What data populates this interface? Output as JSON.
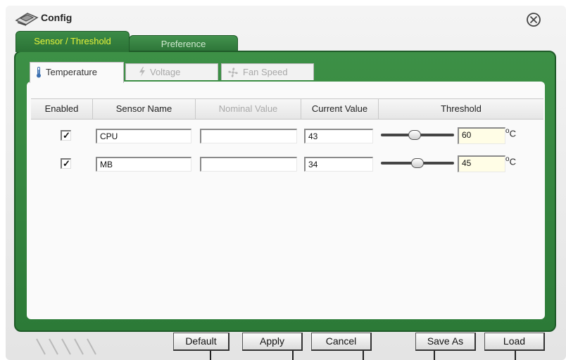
{
  "window": {
    "title": "Config"
  },
  "main_tabs": [
    {
      "label": "Sensor / Threshold",
      "active": true
    },
    {
      "label": "Preference",
      "active": false
    }
  ],
  "sub_tabs": [
    {
      "label": "Temperature",
      "icon": "thermometer-icon",
      "active": true
    },
    {
      "label": "Voltage",
      "icon": "lightning-icon",
      "active": false
    },
    {
      "label": "Fan Speed",
      "icon": "fan-icon",
      "active": false
    }
  ],
  "table": {
    "headers": {
      "enabled": "Enabled",
      "sensor_name": "Sensor Name",
      "nominal_value": "Nominal Value",
      "current_value": "Current Value",
      "threshold": "Threshold"
    },
    "rows": [
      {
        "enabled": true,
        "enabled_mark": "✓",
        "sensor_name": "CPU",
        "nominal_value": "",
        "current_value": "43",
        "threshold": "60",
        "slider_fraction": 0.44
      },
      {
        "enabled": true,
        "enabled_mark": "✓",
        "sensor_name": "MB",
        "nominal_value": "",
        "current_value": "34",
        "threshold": "45",
        "slider_fraction": 0.49
      }
    ],
    "unit_degree": "o",
    "unit_letter": "C"
  },
  "buttons": {
    "default": "Default",
    "apply": "Apply",
    "cancel": "Cancel",
    "save_as": "Save As",
    "load": "Load"
  },
  "colors": {
    "frame_green": "#2c7a37",
    "active_tab_text": "#e6f23a",
    "threshold_field_bg": "#fffde6"
  }
}
